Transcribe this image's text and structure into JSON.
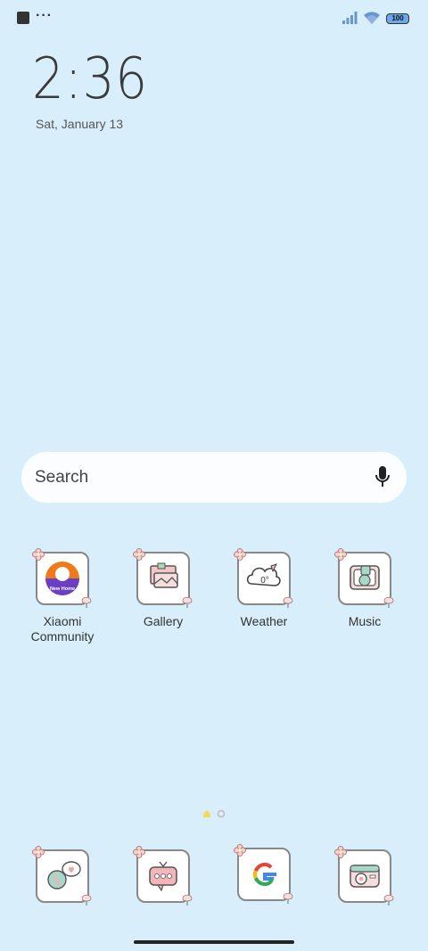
{
  "status_bar": {
    "more_dots": "···",
    "battery": "100"
  },
  "clock": {
    "time": "2:36",
    "date": "Sat, January 13"
  },
  "search": {
    "label": "Search"
  },
  "apps": [
    {
      "label": "Xiaomi\nCommunity",
      "icon": "xiaomi-community-icon",
      "badge": "New Home"
    },
    {
      "label": "Gallery",
      "icon": "gallery-icon"
    },
    {
      "label": "Weather",
      "icon": "weather-icon",
      "temp": "0°"
    },
    {
      "label": "Music",
      "icon": "music-icon"
    }
  ],
  "dock": [
    {
      "icon": "messaging-icon"
    },
    {
      "icon": "chat-tv-icon"
    },
    {
      "icon": "google-icon"
    },
    {
      "icon": "camera-icon"
    }
  ],
  "colors": {
    "background": "#d8eefa",
    "search_bg": "#fbfdff",
    "battery_fill": "#6aa8e8"
  }
}
